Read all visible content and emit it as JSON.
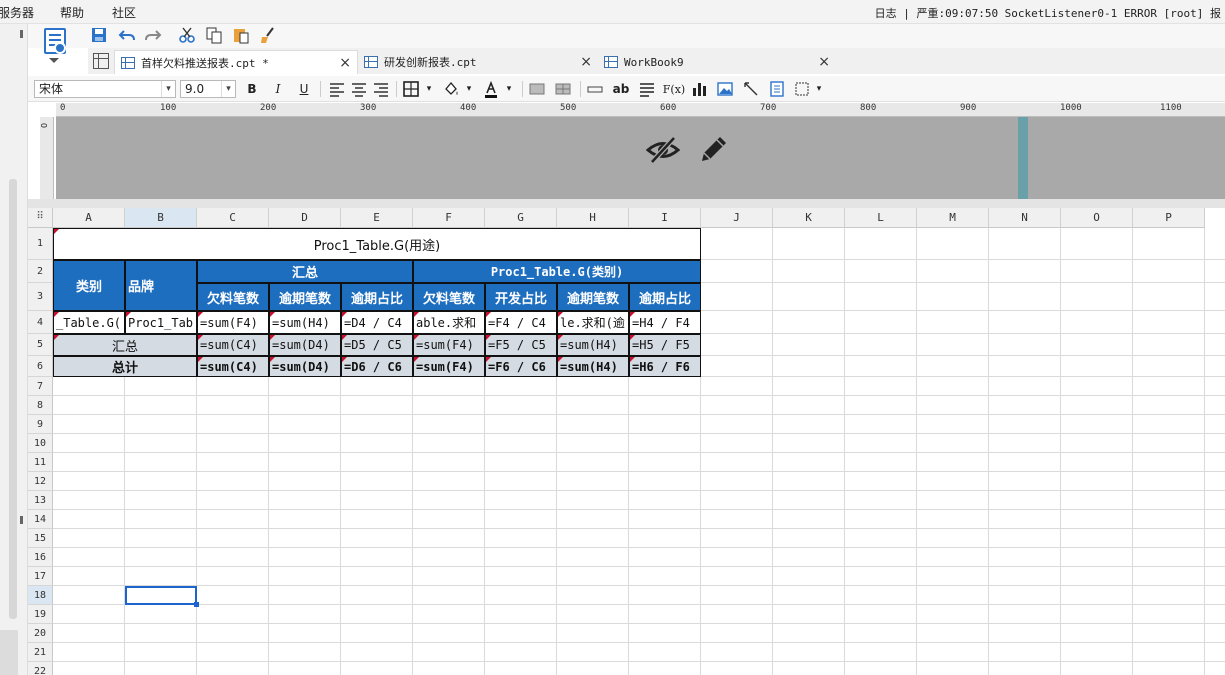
{
  "menu": [
    "服务器",
    "帮助",
    "社区"
  ],
  "status_text": "日志 | 严重:09:07:50 SocketListener0-1 ERROR [root] 报",
  "tabs": [
    {
      "label": "首样欠料推送报表.cpt *",
      "active": true
    },
    {
      "label": "研发创新报表.cpt",
      "active": false
    },
    {
      "label": "WorkBook9",
      "active": false
    }
  ],
  "tab_close": "×",
  "format_bar": {
    "font_name": "宋体",
    "font_size": "9.0",
    "bold": "B",
    "italic": "I",
    "underline": "U",
    "text_ab": "ab",
    "formula_fx": "F(x)",
    "dropdown": "▾"
  },
  "ruler": {
    "labels": [
      "0",
      "100",
      "200",
      "300",
      "400",
      "500",
      "600",
      "700",
      "800",
      "900",
      "1000",
      "1100"
    ],
    "vertical": "0"
  },
  "columns": [
    "A",
    "B",
    "C",
    "D",
    "E",
    "F",
    "G",
    "H",
    "I",
    "J",
    "K",
    "L",
    "M",
    "N",
    "O",
    "P"
  ],
  "selected_column": "B",
  "rows": [
    "1",
    "2",
    "3",
    "4",
    "5",
    "6",
    "7",
    "8",
    "9",
    "10",
    "11",
    "12",
    "13",
    "14",
    "15",
    "16",
    "17",
    "18",
    "19",
    "20",
    "21",
    "22"
  ],
  "selected_row": "18",
  "report": {
    "title": "Proc1_Table.G(用途)",
    "col_type": "类别",
    "col_brand": "品牌",
    "group_summary": "汇总",
    "group_category": "Proc1_Table.G(类别)",
    "subheaders": [
      "欠料笔数",
      "逾期笔数",
      "逾期占比",
      "欠料笔数",
      "开发占比",
      "逾期笔数",
      "逾期占比"
    ],
    "row4": [
      "_Table.G(",
      "Proc1_Tab",
      "=sum(F4)",
      "=sum(H4)",
      "=D4 / C4",
      "able.求和",
      "=F4 / C4",
      "le.求和(逾",
      "=H4 / F4"
    ],
    "row5_label": "汇总",
    "row5": [
      "=sum(C4)",
      "=sum(D4)",
      "=D5 / C5",
      "=sum(F4)",
      "=F5 / C5",
      "=sum(H4)",
      "=H5 / F5"
    ],
    "row6_label": "总计",
    "row6": [
      "=sum(C4)",
      "=sum(D4)",
      "=D6 / C6",
      "=sum(F4)",
      "=F6 / C6",
      "=sum(H4)",
      "=H6 / F6"
    ]
  },
  "colors": {
    "header_blue": "#1e6ebf",
    "summary_gray": "#d4dbe3",
    "selection": "#1e64d0"
  }
}
